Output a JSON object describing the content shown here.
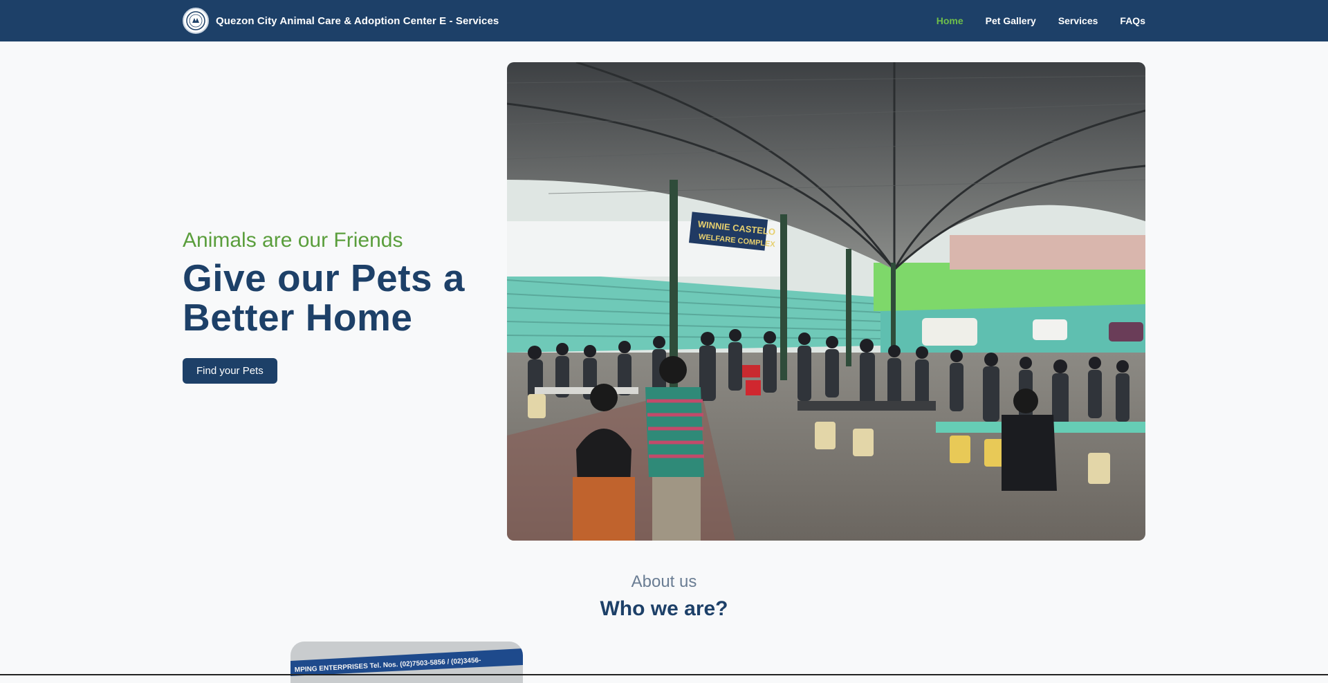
{
  "navbar": {
    "title": "Quezon City Animal Care & Adoption Center E - Services",
    "links": [
      {
        "label": "Home",
        "active": true
      },
      {
        "label": "Pet Gallery",
        "active": false
      },
      {
        "label": "Services",
        "active": false
      },
      {
        "label": "FAQs",
        "active": false
      }
    ]
  },
  "hero": {
    "tagline": "Animals are our Friends",
    "headline_line1": "Give our Pets a",
    "headline_line2": "Better Home",
    "cta_label": "Find your Pets",
    "photo_banner": "WINNIE CASTELO WELFARE COMPLEX"
  },
  "about": {
    "subtitle": "About us",
    "title": "Who we are?",
    "photo_banner": "MPING ENTERPRISES  Tel. Nos. (02)7503-5856 / (02)3456-"
  },
  "colors": {
    "navy": "#1d4068",
    "green": "#5a9e3c",
    "active_link": "#6fbf4a",
    "background": "#f8f9fa"
  }
}
